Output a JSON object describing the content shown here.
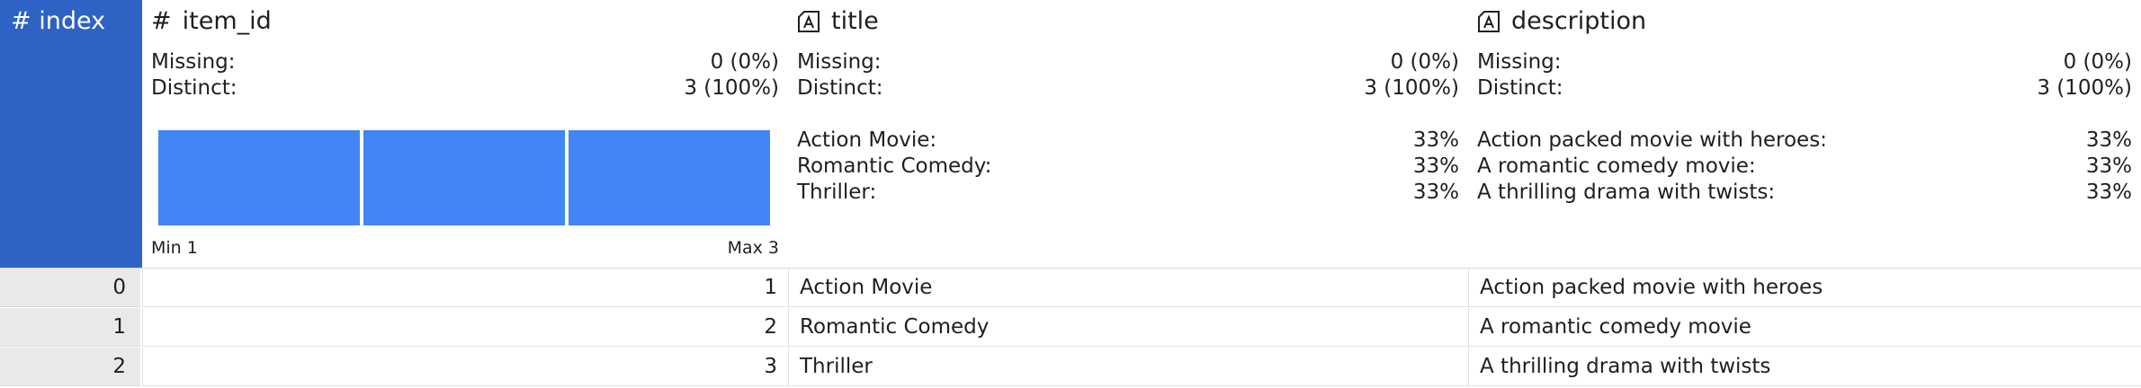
{
  "index_header": {
    "icon": "#",
    "label": "index"
  },
  "columns": [
    {
      "key": "item_id",
      "icon": "#",
      "label": "item_id",
      "missing_label": "Missing:",
      "missing_value": "0 (0%)",
      "distinct_label": "Distinct:",
      "distinct_value": "3 (100%)",
      "histogram": {
        "bars": 3
      },
      "min_label": "Min 1",
      "max_label": "Max 3"
    },
    {
      "key": "title",
      "icon": "text-type-icon",
      "label": "title",
      "missing_label": "Missing:",
      "missing_value": "0 (0%)",
      "distinct_label": "Distinct:",
      "distinct_value": "3 (100%)",
      "freq": [
        {
          "label": "Action Movie:",
          "pct": "33%"
        },
        {
          "label": "Romantic Comedy:",
          "pct": "33%"
        },
        {
          "label": "Thriller:",
          "pct": "33%"
        }
      ]
    },
    {
      "key": "description",
      "icon": "text-type-icon",
      "label": "description",
      "missing_label": "Missing:",
      "missing_value": "0 (0%)",
      "distinct_label": "Distinct:",
      "distinct_value": "3 (100%)",
      "freq": [
        {
          "label": "Action packed movie with heroes:",
          "pct": "33%"
        },
        {
          "label": "A romantic comedy movie:",
          "pct": "33%"
        },
        {
          "label": "A thrilling drama with twists:",
          "pct": "33%"
        }
      ]
    }
  ],
  "rows": [
    {
      "index": "0",
      "item_id": "1",
      "title": "Action Movie",
      "description": "Action packed movie with heroes"
    },
    {
      "index": "1",
      "item_id": "2",
      "title": "Romantic Comedy",
      "description": "A romantic comedy movie"
    },
    {
      "index": "2",
      "item_id": "3",
      "title": "Thriller",
      "description": "A thrilling drama with twists"
    }
  ]
}
